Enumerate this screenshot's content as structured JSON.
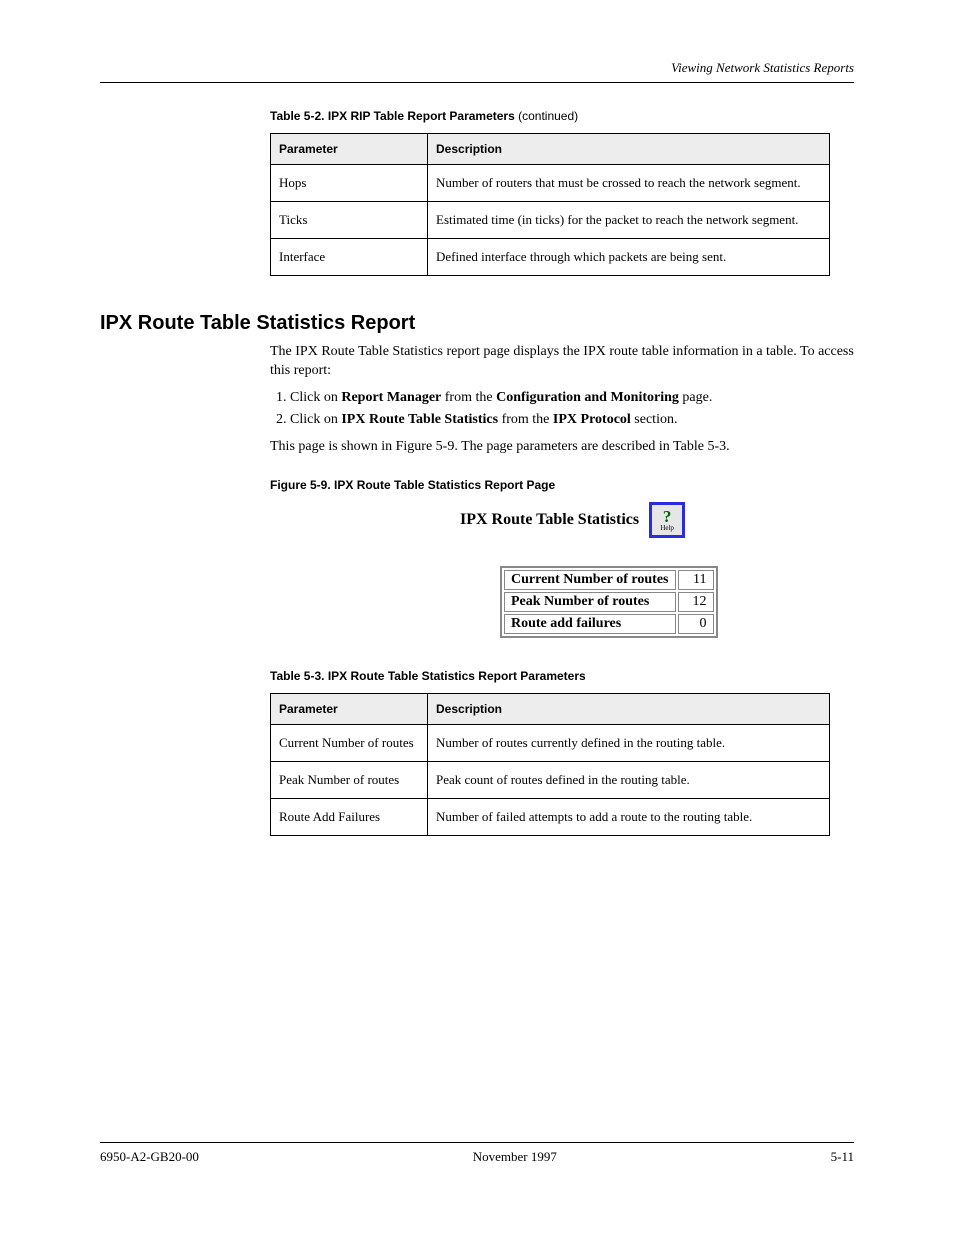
{
  "running_head": "Viewing Network Statistics Reports",
  "table1": {
    "caption_label": "Table 5-2.",
    "caption_text": "IPX RIP Table Report Parameters",
    "continued": " (continued)",
    "header": {
      "param": "Parameter",
      "desc": "Description"
    },
    "rows": [
      {
        "param": "Hops",
        "desc": "Number of routers that must be crossed to reach the network segment."
      },
      {
        "param": "Ticks",
        "desc": "Estimated time (in ticks) for the packet to reach the network segment."
      },
      {
        "param": "Interface",
        "desc": "Defined interface through which packets are being sent."
      }
    ]
  },
  "section": {
    "title": "IPX Route Table Statistics Report",
    "intro": "The IPX Route Table Statistics report page displays the IPX route table information in a table. To access this report:",
    "steps": [
      {
        "prefix": "Click on ",
        "bold1": "Report Manager",
        "mid": " from the ",
        "bold2": "Configuration and Monitoring",
        "suffix": " page."
      },
      {
        "prefix": "Click on ",
        "bold1": "IPX Route Table Statistics",
        "mid": " from the ",
        "bold2": "IPX Protocol",
        "suffix": " section."
      }
    ],
    "figure_ref_prefix": "This page is shown in ",
    "figure_ref": "Figure 5-9",
    "figure_ref_mid": ". The page parameters are described in ",
    "table_ref": "Table 5-3",
    "figure_ref_suffix": "."
  },
  "figure": {
    "caption": "Figure 5-9. IPX Route Table Statistics Report Page",
    "title": "IPX Route Table Statistics",
    "help_label": "Help",
    "stats": [
      {
        "label": "Current Number of routes",
        "value": "11"
      },
      {
        "label": "Peak Number of routes",
        "value": "12"
      },
      {
        "label": "Route add failures",
        "value": "0"
      }
    ]
  },
  "table2": {
    "caption_label": "Table 5-3.",
    "caption_text": "IPX Route Table Statistics Report Parameters",
    "header": {
      "param": "Parameter",
      "desc": "Description"
    },
    "rows": [
      {
        "param": "Current Number of routes",
        "desc": "Number of routes currently defined in the routing table."
      },
      {
        "param": "Peak Number of routes",
        "desc": "Peak count of routes defined in the routing table."
      },
      {
        "param": "Route Add Failures",
        "desc": "Number of failed attempts to add a route to the routing table."
      }
    ]
  },
  "footer": {
    "doc": "6950-A2-GB20-00",
    "date": "November 1997",
    "page": "5-11"
  }
}
